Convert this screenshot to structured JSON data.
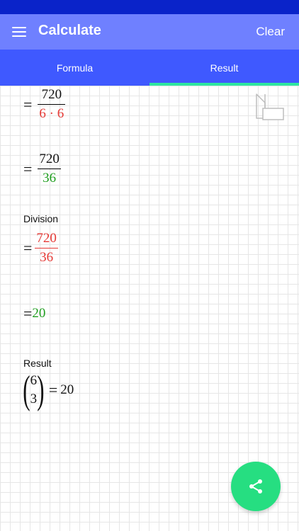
{
  "app_bar": {
    "title": "Calculate",
    "clear_label": "Clear",
    "menu_icon": "hamburger-menu-icon"
  },
  "tabs": [
    {
      "label": "Formula",
      "active": false
    },
    {
      "label": "Result",
      "active": true
    }
  ],
  "steps": {
    "step1": {
      "numerator": "720",
      "denominator": "6 · 6"
    },
    "step2": {
      "numerator": "720",
      "denominator": "36"
    },
    "division_label": "Division",
    "step3": {
      "numerator": "720",
      "denominator": "36"
    },
    "step4": {
      "value": "20"
    },
    "result_label": "Result",
    "result": {
      "n": "6",
      "k": "3",
      "value": "20"
    }
  },
  "icons": {
    "ruler": "ruler-triangle-icon",
    "share": "share-icon"
  },
  "colors": {
    "status_bar": "#0a23c9",
    "app_bar": "#6f80ff",
    "tab_bar": "#3f59ff",
    "tab_indicator": "#2ee6a0",
    "fab": "#26de81",
    "red_term": "#e53935",
    "green_term": "#1f9e1f"
  }
}
